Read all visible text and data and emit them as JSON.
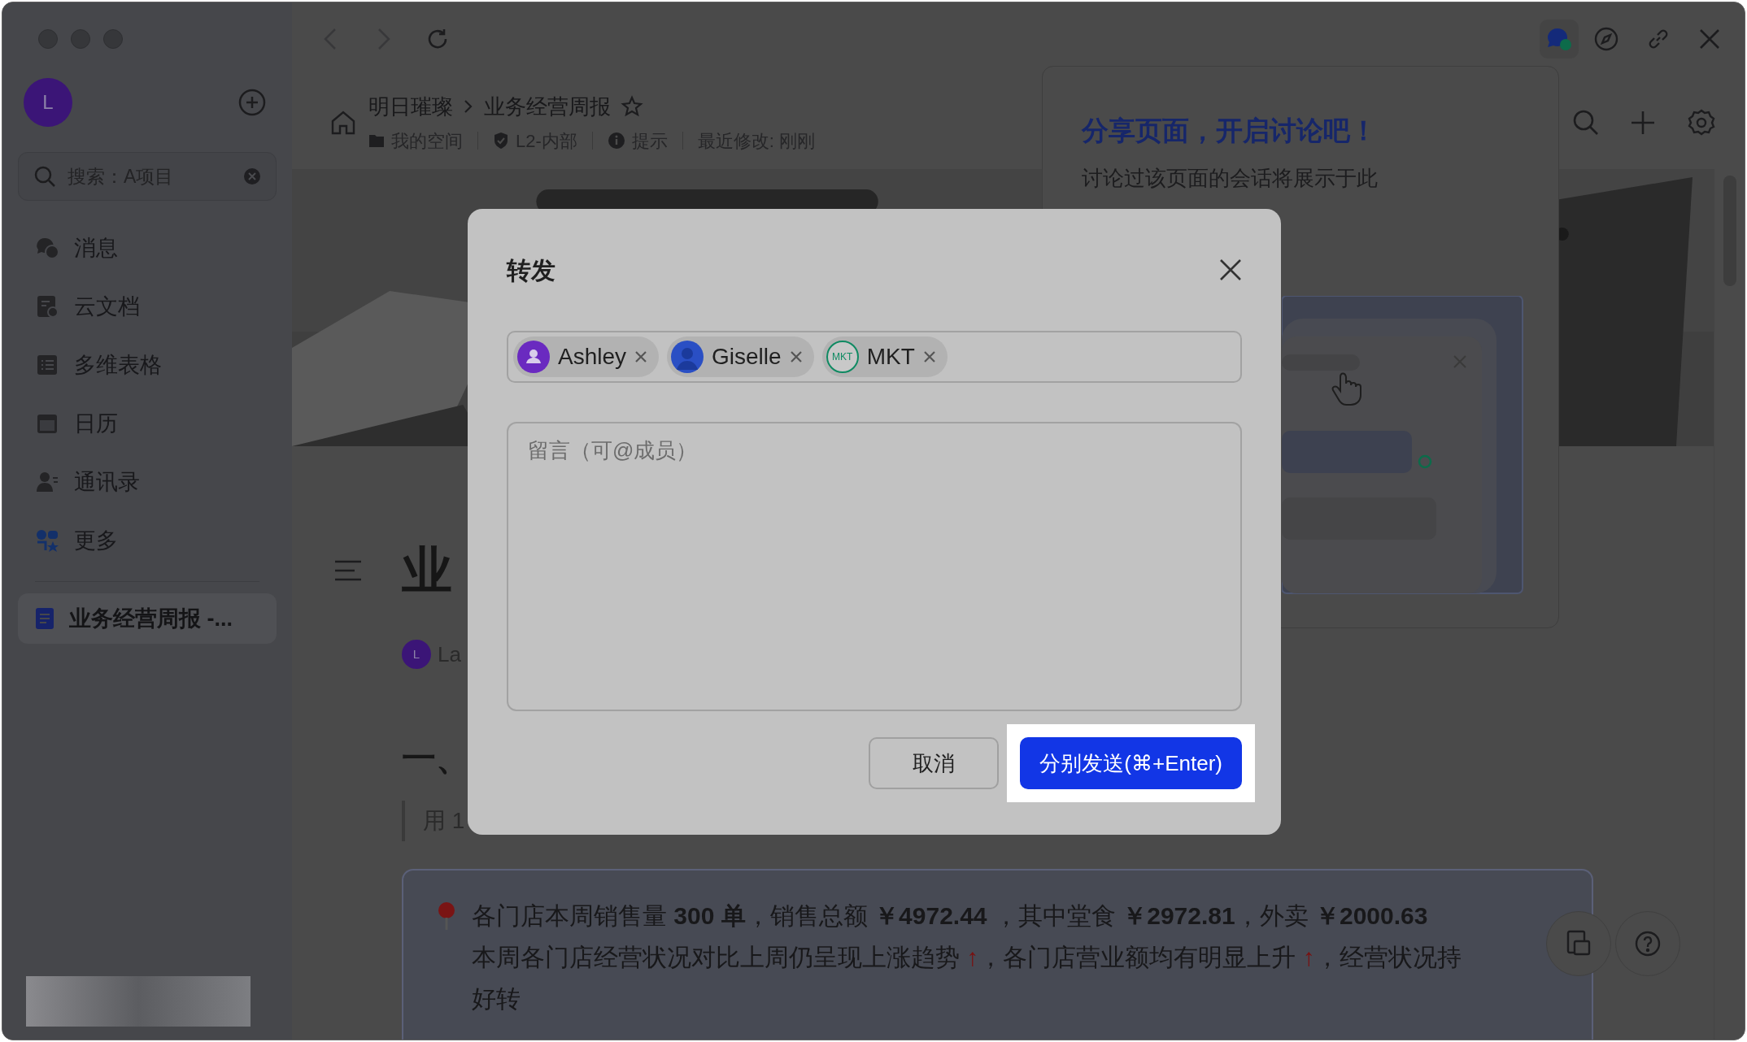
{
  "sidebar": {
    "avatar": "L",
    "search": {
      "value": "搜索：A项目"
    },
    "nav_items": [
      {
        "label": "消息",
        "selected": false
      },
      {
        "label": "云文档",
        "selected": false
      },
      {
        "label": "多维表格",
        "selected": false
      },
      {
        "label": "日历",
        "selected": false
      },
      {
        "label": "通讯录",
        "selected": false
      },
      {
        "label": "更多",
        "selected": false
      }
    ],
    "recent_docs": [
      {
        "label": "业务经营周报 -...",
        "selected": true
      }
    ]
  },
  "header": {
    "breadcrumb": [
      "明日璀璨",
      "业务经营周报"
    ],
    "meta": [
      "我的空间",
      "L2-内部",
      "提示",
      "最近修改: 刚刚"
    ]
  },
  "share_panel": {
    "title": "分享页面，开启讨论吧！",
    "subtitle": "讨论过该页面的会话将展示于此"
  },
  "document": {
    "title": "业",
    "author_initial": "L",
    "author": "La",
    "heading": "一、",
    "quote": "用 1",
    "callout": {
      "lines": [
        [
          {
            "kind": "text",
            "text": "各门店本周销售量 **300 单**，销售总额 **￥4972.44** ，其中堂食 **￥2972.81**，外卖 **￥2000.63**"
          }
        ],
        [
          {
            "kind": "text",
            "text": "本周各门店经营状况对比上周仍呈现上涨趋势 "
          },
          {
            "kind": "up-arrow",
            "text": "↑"
          },
          {
            "kind": "text",
            "text": "，各门店营业额均有明显上升 "
          },
          {
            "kind": "up-arrow",
            "text": "↑"
          },
          {
            "kind": "text",
            "text": "，经营状况持"
          }
        ],
        [
          {
            "kind": "text",
            "text": "好转"
          }
        ]
      ]
    }
  },
  "dialog": {
    "title": "转发",
    "recipients": [
      {
        "name": "Ashley",
        "kind": "default-avatar"
      },
      {
        "name": "Giselle",
        "kind": "photo-avatar"
      },
      {
        "name": "MKT",
        "kind": "group",
        "avatar_text": "MKT"
      }
    ],
    "message": {
      "placeholder": "留言（可@成员）"
    },
    "cancel": "取消",
    "send": {
      "label": "分别发送(⌘+Enter)",
      "highlighted": true
    }
  }
}
